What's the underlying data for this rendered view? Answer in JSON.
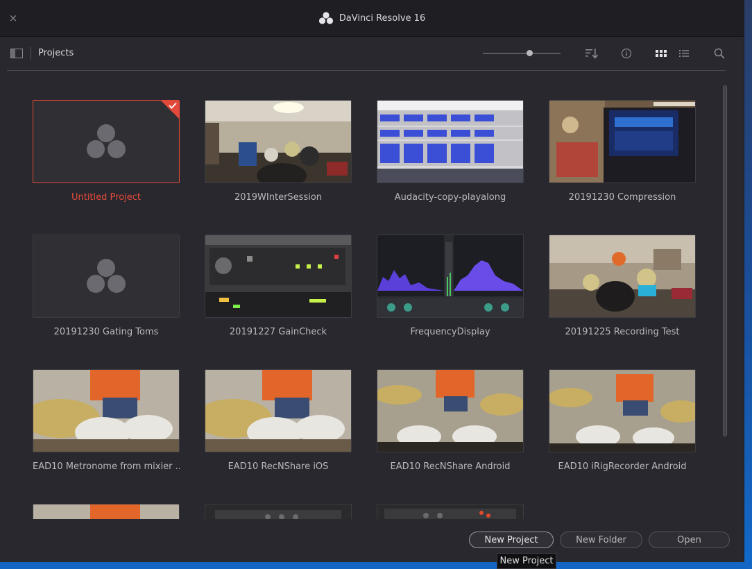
{
  "window": {
    "title": "DaVinci Resolve 16",
    "close_glyph": "×"
  },
  "toolbar": {
    "section_label": "Projects",
    "icons": {
      "panel": "panel-toggle-icon",
      "sort": "sort-icon",
      "info": "info-icon",
      "grid": "grid-view-icon",
      "list": "list-view-icon",
      "search": "search-icon"
    },
    "zoom_level": 0.6
  },
  "projects": [
    {
      "name": "Untitled Project",
      "selected": true,
      "thumb": "blank"
    },
    {
      "name": "2019WInterSession",
      "thumb": "studio-room"
    },
    {
      "name": "Audacity-copy-playalong",
      "thumb": "audacity"
    },
    {
      "name": "20191230 Compression",
      "thumb": "desk-laptop"
    },
    {
      "name": "20191230 Gating Toms",
      "thumb": "blank"
    },
    {
      "name": "20191227 GainCheck",
      "thumb": "rack-unit"
    },
    {
      "name": "FrequencyDisplay",
      "thumb": "eq-plugin"
    },
    {
      "name": "20191225 Recording Test",
      "thumb": "drumkit-room"
    },
    {
      "name": "EAD10 Metronome from mixier ...",
      "thumb": "drummer-close"
    },
    {
      "name": "EAD10 RecNShare iOS",
      "thumb": "drummer-close"
    },
    {
      "name": "EAD10 RecNShare Android",
      "thumb": "drummer-wide"
    },
    {
      "name": "EAD10 iRigRecorder Android",
      "thumb": "drummer-wide"
    },
    {
      "name": "",
      "thumb": "drummer-close"
    },
    {
      "name": "",
      "thumb": "device-dark"
    },
    {
      "name": "",
      "thumb": "device-dark"
    }
  ],
  "buttons": {
    "new_project": "New Project",
    "new_folder": "New Folder",
    "open": "Open"
  },
  "tooltip": {
    "text": "New Project"
  },
  "colors": {
    "accent": "#e3493b",
    "background": "#28282e",
    "titlebar": "#1f1f23"
  }
}
